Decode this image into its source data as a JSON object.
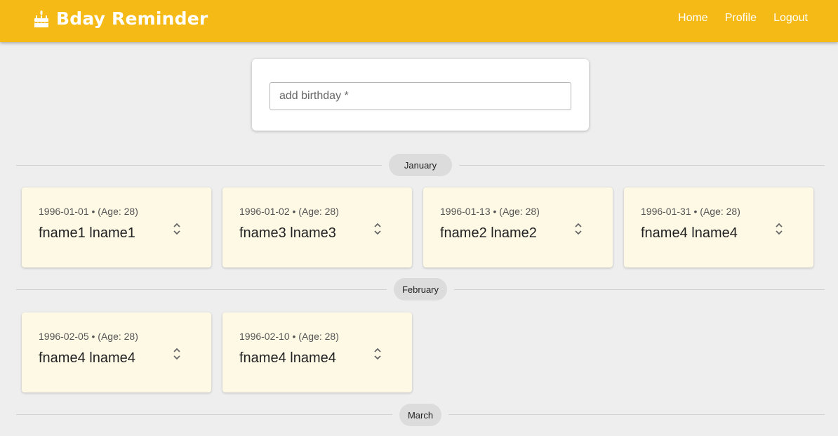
{
  "header": {
    "title": "Bday Reminder",
    "brand_icon": "cake-icon",
    "nav": [
      {
        "label": "Home"
      },
      {
        "label": "Profile"
      },
      {
        "label": "Logout"
      }
    ],
    "color": "#f5ba16"
  },
  "add_form": {
    "placeholder": "add birthday *"
  },
  "months": [
    {
      "label": "January"
    },
    {
      "label": "February"
    },
    {
      "label": "March"
    }
  ],
  "birthdays": {
    "january": [
      {
        "date": "1996-01-01 • (Age: 28)",
        "name": "fname1 lname1"
      },
      {
        "date": "1996-01-02 • (Age: 28)",
        "name": "fname3 lname3"
      },
      {
        "date": "1996-01-13 • (Age: 28)",
        "name": "fname2 lname2"
      },
      {
        "date": "1996-01-31 • (Age: 28)",
        "name": "fname4 lname4"
      }
    ],
    "february": [
      {
        "date": "1996-02-05 • (Age: 28)",
        "name": "fname4 lname4"
      },
      {
        "date": "1996-02-10 • (Age: 28)",
        "name": "fname4 lname4"
      }
    ]
  },
  "card_color": "#fef9e5"
}
